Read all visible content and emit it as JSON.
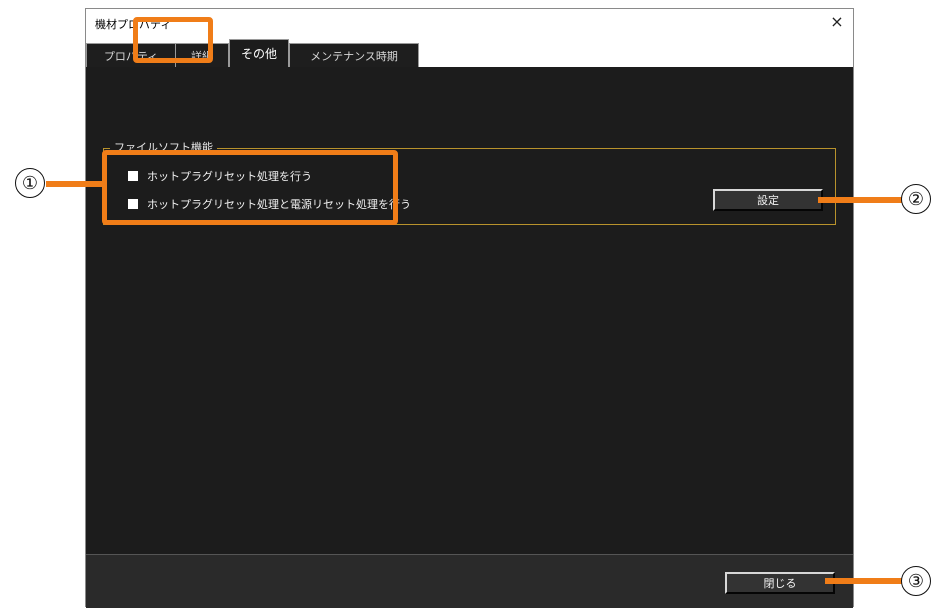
{
  "window": {
    "title": "機材プロパティ",
    "close_label": "×"
  },
  "tabs": [
    {
      "label": "プロパティ",
      "active": false
    },
    {
      "label": "詳細",
      "active": false
    },
    {
      "label": "その他",
      "active": true
    },
    {
      "label": "メンテナンス時期",
      "active": false
    }
  ],
  "failsoft": {
    "group_label": "ファイルソフト機能",
    "options": [
      {
        "label": "ホットプラグリセット処理を行う",
        "checked": false
      },
      {
        "label": "ホットプラグリセット処理と電源リセット処理を行う",
        "checked": false
      }
    ],
    "settings_button": "設定"
  },
  "footer": {
    "close_button": "閉じる"
  },
  "callouts": [
    "①",
    "②",
    "③"
  ],
  "colors": {
    "highlight": "#f07d18",
    "panel_bg": "#1c1c1c",
    "group_border": "#b8922c"
  }
}
